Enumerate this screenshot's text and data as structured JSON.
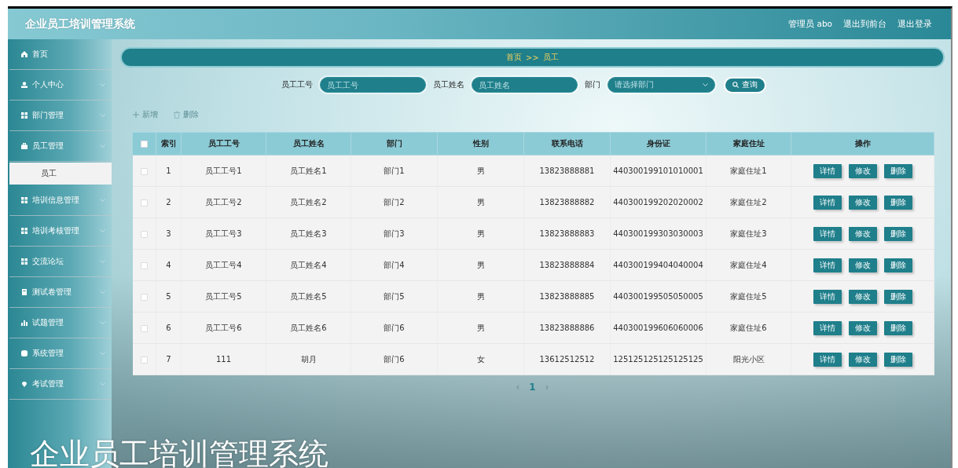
{
  "header": {
    "title": "企业员工培训管理系统",
    "links": [
      "管理员 abo",
      "退出到前台",
      "退出登录"
    ]
  },
  "sidebar": {
    "items": [
      {
        "label": "首页",
        "kind": "link"
      },
      {
        "label": "个人中心",
        "kind": "group"
      },
      {
        "label": "部门管理",
        "kind": "group"
      },
      {
        "label": "员工管理",
        "kind": "group",
        "children": [
          {
            "label": "员工",
            "selected": true
          }
        ]
      },
      {
        "label": "培训信息管理",
        "kind": "group"
      },
      {
        "label": "培训考核管理",
        "kind": "group"
      },
      {
        "label": "交流论坛",
        "kind": "group"
      },
      {
        "label": "测试卷管理",
        "kind": "group"
      },
      {
        "label": "试题管理",
        "kind": "group"
      },
      {
        "label": "系统管理",
        "kind": "group"
      },
      {
        "label": "考试管理",
        "kind": "group"
      }
    ]
  },
  "breadcrumb": {
    "items": [
      "首页",
      "员工"
    ],
    "separator": ">>"
  },
  "search": {
    "fields": [
      {
        "label": "员工工号",
        "placeholder": "员工工号",
        "kind": "input"
      },
      {
        "label": "员工姓名",
        "placeholder": "员工姓名",
        "kind": "input"
      },
      {
        "label": "部门",
        "placeholder": "请选择部门",
        "kind": "select"
      }
    ],
    "button": "查询"
  },
  "actions": [
    {
      "label": "新增",
      "kind": "add"
    },
    {
      "label": "删除",
      "kind": "delete"
    }
  ],
  "table": {
    "header_checked": false,
    "columns": [
      "索引",
      "员工工号",
      "员工姓名",
      "部门",
      "性别",
      "联系电话",
      "身份证",
      "家庭住址",
      "操作"
    ],
    "rows": [
      {
        "checked": false,
        "cells": [
          "1",
          "员工工号1",
          "员工姓名1",
          "部门1",
          "男",
          "13823888881",
          "440300199101010001",
          "家庭住址1"
        ],
        "actions": [
          "详情",
          "修改",
          "删除"
        ]
      },
      {
        "checked": false,
        "cells": [
          "2",
          "员工工号2",
          "员工姓名2",
          "部门2",
          "男",
          "13823888882",
          "440300199202020002",
          "家庭住址2"
        ],
        "actions": [
          "详情",
          "修改",
          "删除"
        ]
      },
      {
        "checked": false,
        "cells": [
          "3",
          "员工工号3",
          "员工姓名3",
          "部门3",
          "男",
          "13823888883",
          "440300199303030003",
          "家庭住址3"
        ],
        "actions": [
          "详情",
          "修改",
          "删除"
        ]
      },
      {
        "checked": false,
        "cells": [
          "4",
          "员工工号4",
          "员工姓名4",
          "部门4",
          "男",
          "13823888884",
          "440300199404040004",
          "家庭住址4"
        ],
        "actions": [
          "详情",
          "修改",
          "删除"
        ]
      },
      {
        "checked": false,
        "cells": [
          "5",
          "员工工号5",
          "员工姓名5",
          "部门5",
          "男",
          "13823888885",
          "440300199505050005",
          "家庭住址5"
        ],
        "actions": [
          "详情",
          "修改",
          "删除"
        ]
      },
      {
        "checked": false,
        "cells": [
          "6",
          "员工工号6",
          "员工姓名6",
          "部门6",
          "男",
          "13823888886",
          "440300199606060006",
          "家庭住址6"
        ],
        "actions": [
          "详情",
          "修改",
          "删除"
        ]
      },
      {
        "checked": false,
        "cells": [
          "7",
          "111",
          "胡月",
          "部门6",
          "女",
          "13612512512",
          "125125125125125125",
          "阳光小区"
        ],
        "actions": [
          "详情",
          "修改",
          "删除"
        ]
      }
    ]
  },
  "pagination": {
    "prev": "‹",
    "next": "›",
    "pages": [
      {
        "label": "1",
        "selected": true
      }
    ]
  },
  "caption": "企业员工培训管理系统"
}
